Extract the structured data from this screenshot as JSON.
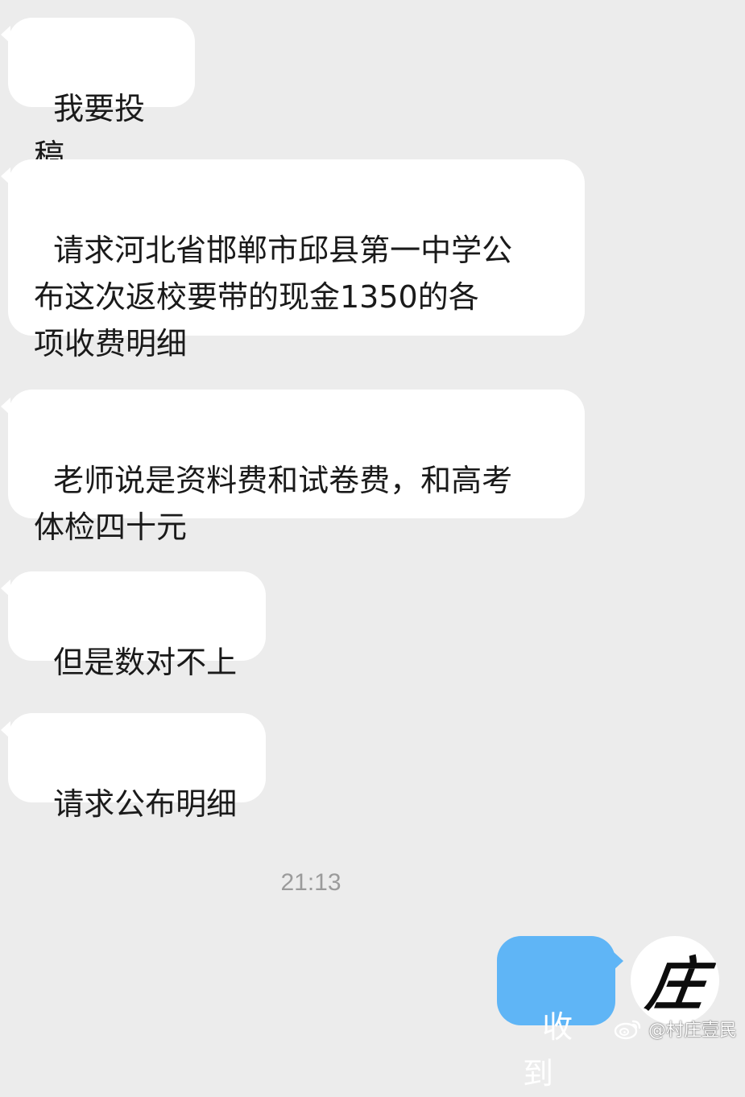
{
  "messages": [
    {
      "direction": "incoming",
      "text": "我要投稿"
    },
    {
      "direction": "incoming",
      "text": "请求河北省邯郸市邱县第一中学公\n布这次返校要带的现金1350的各\n项收费明细"
    },
    {
      "direction": "incoming",
      "text": "老师说是资料费和试卷费，和高考\n体检四十元"
    },
    {
      "direction": "incoming",
      "text": "但是数对不上"
    },
    {
      "direction": "incoming",
      "text": "请求公布明细"
    }
  ],
  "timestamp": "21:13",
  "reply": {
    "direction": "outgoing",
    "text": "收到"
  },
  "avatar": {
    "glyph": "庄",
    "icon": "calligraphy-avatar"
  },
  "watermark": {
    "icon": "weibo-icon",
    "text": "@村庄壹民"
  },
  "colors": {
    "background": "#ececec",
    "incoming_bubble": "#ffffff",
    "outgoing_bubble": "#5fb5f6",
    "timestamp_text": "#9b9b9b"
  }
}
